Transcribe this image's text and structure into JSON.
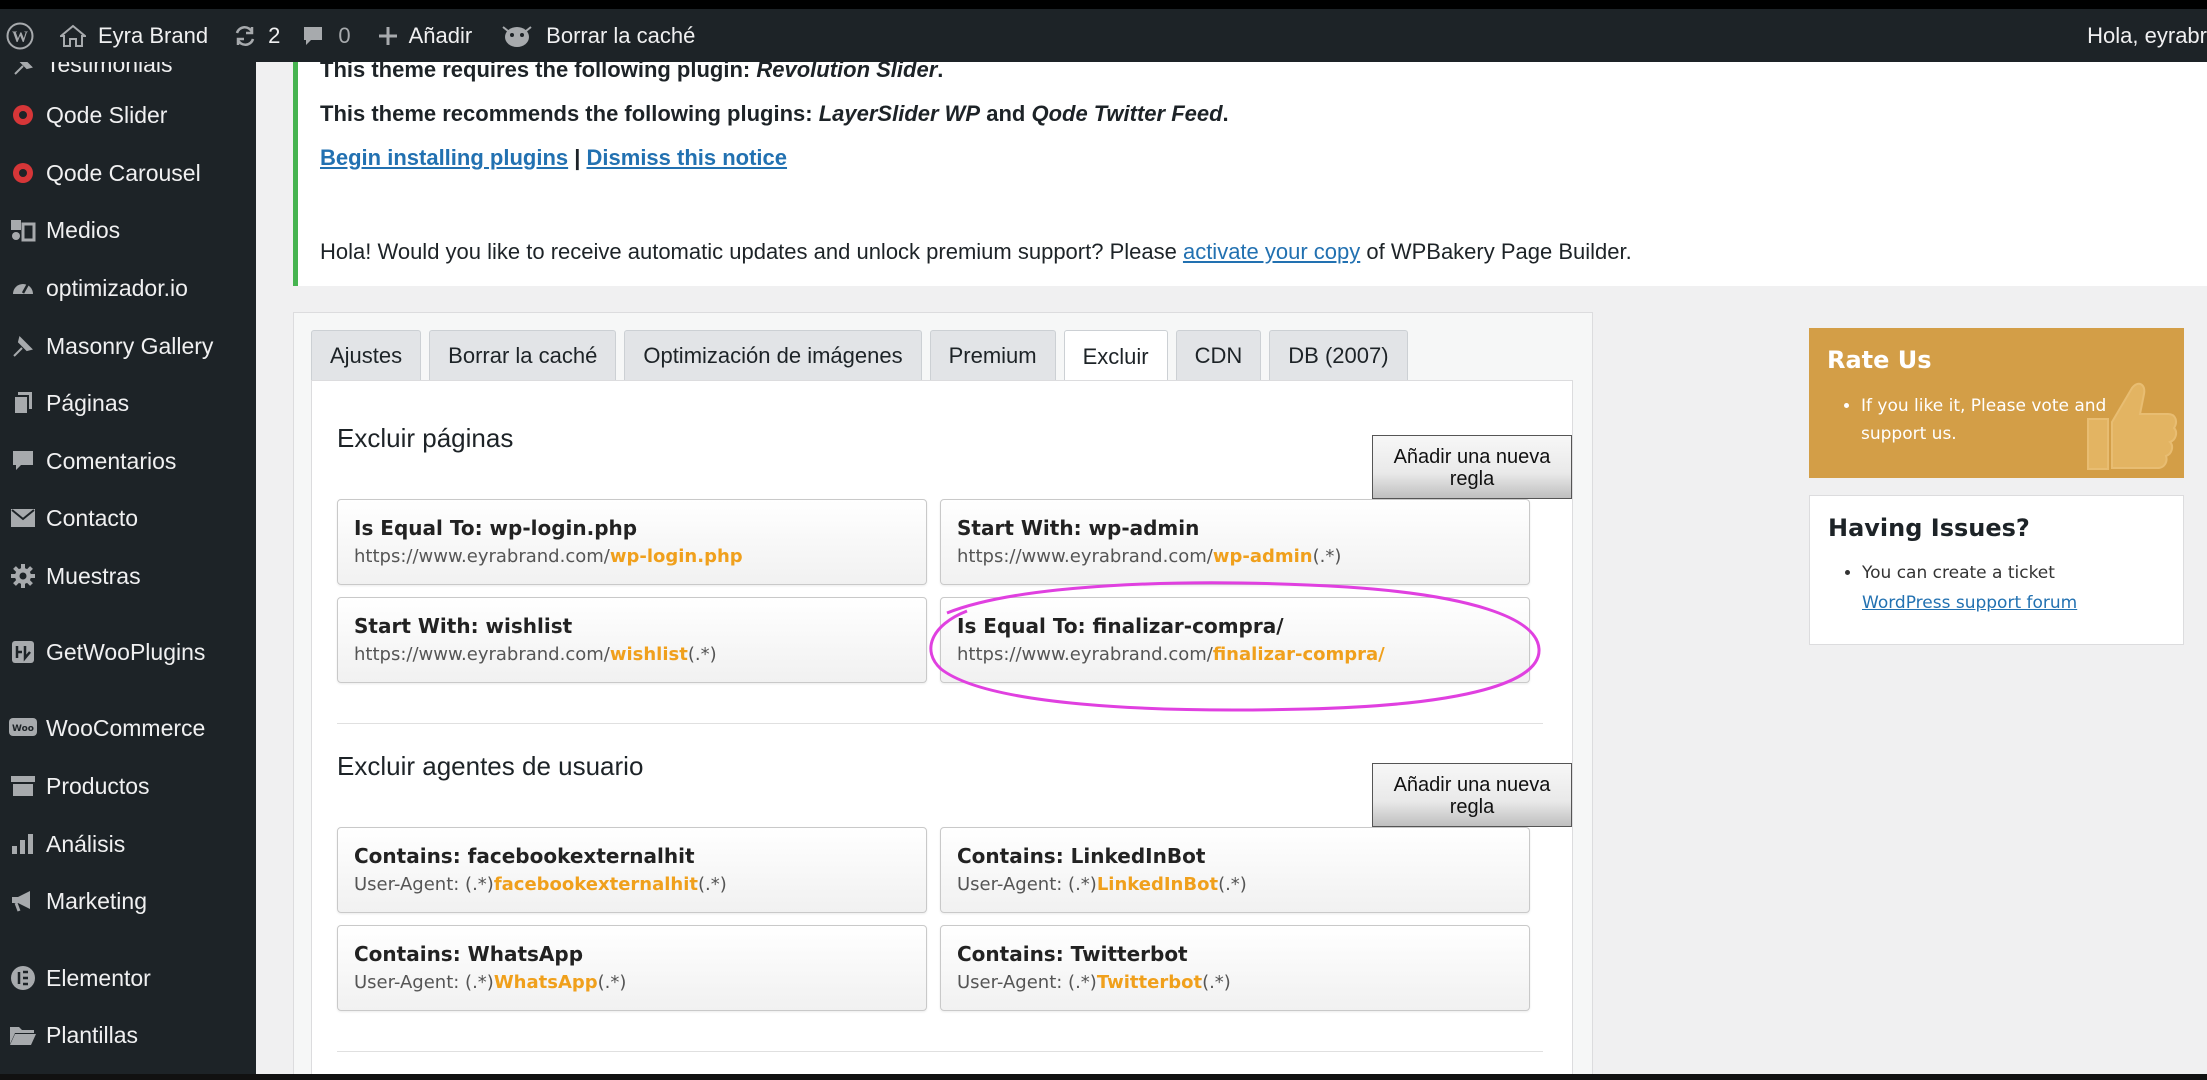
{
  "adminbar": {
    "site_name": "Eyra Brand",
    "updates_count": "2",
    "comments_count": "0",
    "new_label": "Añadir",
    "cache_label": "Borrar la caché",
    "greeting": "Hola, eyrabr"
  },
  "sidebar": {
    "items": [
      {
        "label": "Testimonials"
      },
      {
        "label": "Qode Slider"
      },
      {
        "label": "Qode Carousel"
      },
      {
        "label": "Medios"
      },
      {
        "label": "optimizador.io"
      },
      {
        "label": "Masonry Gallery"
      },
      {
        "label": "Páginas"
      },
      {
        "label": "Comentarios"
      },
      {
        "label": "Contacto"
      },
      {
        "label": "Muestras"
      },
      {
        "label": "GetWooPlugins"
      },
      {
        "label": "WooCommerce"
      },
      {
        "label": "Productos"
      },
      {
        "label": "Análisis"
      },
      {
        "label": "Marketing"
      },
      {
        "label": "Elementor"
      },
      {
        "label": "Plantillas"
      }
    ]
  },
  "notices": {
    "plugin_required_prefix": "This theme requires the following plugin: ",
    "plugin_required_name": "Revolution Slider",
    "plugin_required_suffix": ".",
    "recommend_prefix": "This theme recommends the following plugins: ",
    "recommend_a": "LayerSlider WP",
    "recommend_and": " and ",
    "recommend_b": "Qode Twitter Feed",
    "recommend_suffix": ".",
    "begin_installing": "Begin installing plugins",
    "separator": " | ",
    "dismiss": "Dismiss this notice",
    "wpbakery_prefix": "Hola! Would you like to receive automatic updates and unlock premium support? Please ",
    "wpbakery_link": "activate your copy",
    "wpbakery_suffix": " of WPBakery Page Builder."
  },
  "tabs": [
    {
      "label": "Ajustes"
    },
    {
      "label": "Borrar la caché"
    },
    {
      "label": "Optimización de imágenes"
    },
    {
      "label": "Premium"
    },
    {
      "label": "Excluir"
    },
    {
      "label": "CDN"
    },
    {
      "label": "DB (2007)"
    }
  ],
  "exclude_pages": {
    "title": "Excluir páginas",
    "add_rule": "Añadir una nueva regla",
    "rules": [
      {
        "title": "Is Equal To: wp-login.php",
        "prefix": "https://www.eyrabrand.com/",
        "highlight": "wp-login.php",
        "suffix": ""
      },
      {
        "title": "Start With: wp-admin",
        "prefix": "https://www.eyrabrand.com/",
        "highlight": "wp-admin",
        "suffix": "(.*)"
      },
      {
        "title": "Start With: wishlist",
        "prefix": "https://www.eyrabrand.com/",
        "highlight": "wishlist",
        "suffix": "(.*)"
      },
      {
        "title": "Is Equal To: finalizar-compra/",
        "prefix": "https://www.eyrabrand.com/",
        "highlight": "finalizar-compra/",
        "suffix": ""
      }
    ]
  },
  "exclude_agents": {
    "title": "Excluir agentes de usuario",
    "add_rule": "Añadir una nueva regla",
    "rules": [
      {
        "title": "Contains: facebookexternalhit",
        "prefix": "User-Agent: (.*)",
        "highlight": "facebookexternalhit",
        "suffix": "(.*)"
      },
      {
        "title": "Contains: LinkedInBot",
        "prefix": "User-Agent: (.*)",
        "highlight": "LinkedInBot",
        "suffix": "(.*)"
      },
      {
        "title": "Contains: WhatsApp",
        "prefix": "User-Agent: (.*)",
        "highlight": "WhatsApp",
        "suffix": "(.*)"
      },
      {
        "title": "Contains: Twitterbot",
        "prefix": "User-Agent: (.*)",
        "highlight": "Twitterbot",
        "suffix": "(.*)"
      }
    ]
  },
  "rate_us": {
    "title": "Rate Us",
    "text": "If you like it, Please vote and support us."
  },
  "issues": {
    "title": "Having Issues?",
    "text": "You can create a ticket",
    "link": "WordPress support forum"
  },
  "colors": {
    "admin_dark": "#1d2327",
    "accent_orange": "#f0a01c",
    "rate_us_bg": "#d39e47",
    "notice_green": "#46b450",
    "link_blue": "#2271b1",
    "annotation_magenta": "#e040e0"
  }
}
